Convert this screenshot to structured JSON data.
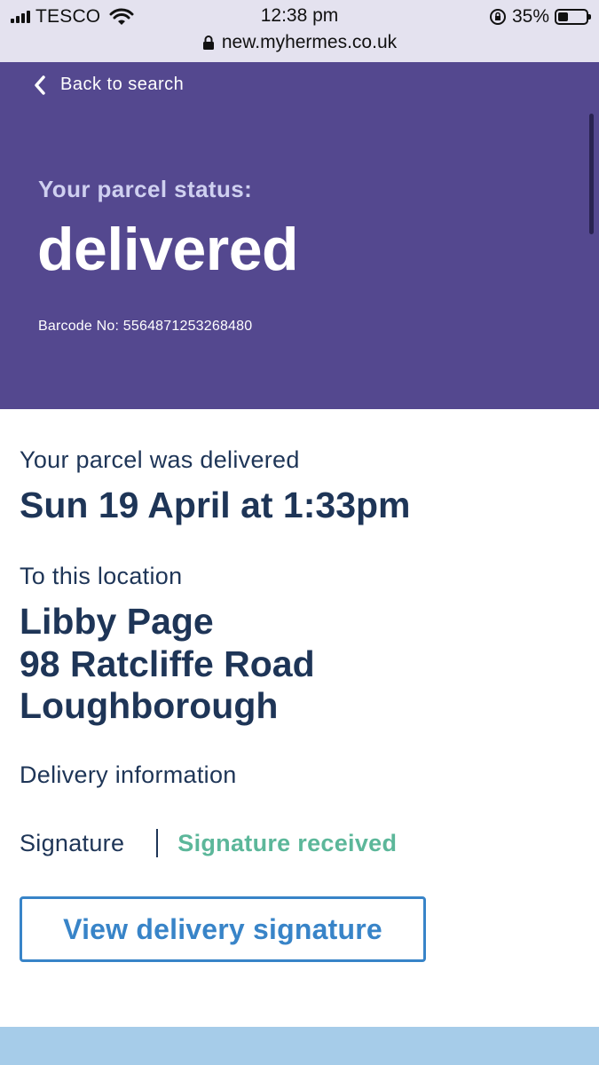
{
  "status_bar": {
    "carrier": "TESCO",
    "time": "12:38 pm",
    "battery_percent": "35%",
    "battery_level": 0.35,
    "url": "new.myhermes.co.uk",
    "icons": [
      "signal-icon",
      "wifi-icon",
      "orientation-lock-icon",
      "battery-icon",
      "padlock-icon"
    ]
  },
  "header": {
    "back_label": "Back to search",
    "status_label": "Your parcel status:",
    "status_value": "delivered",
    "barcode": "Barcode No: 5564871253268480",
    "background_color": "#54488f"
  },
  "delivery": {
    "delivered_label": "Your parcel was delivered",
    "delivered_datetime": "Sun 19 April at 1:33pm",
    "location_label": "To this location",
    "address_lines": [
      "Libby Page",
      "98 Ratcliffe Road",
      "Loughborough"
    ],
    "info_label": "Delivery information",
    "signature_label": "Signature",
    "signature_value": "Signature received",
    "signature_color": "#5cb79a",
    "view_button_label": "View delivery signature",
    "button_color": "#3884c8"
  }
}
